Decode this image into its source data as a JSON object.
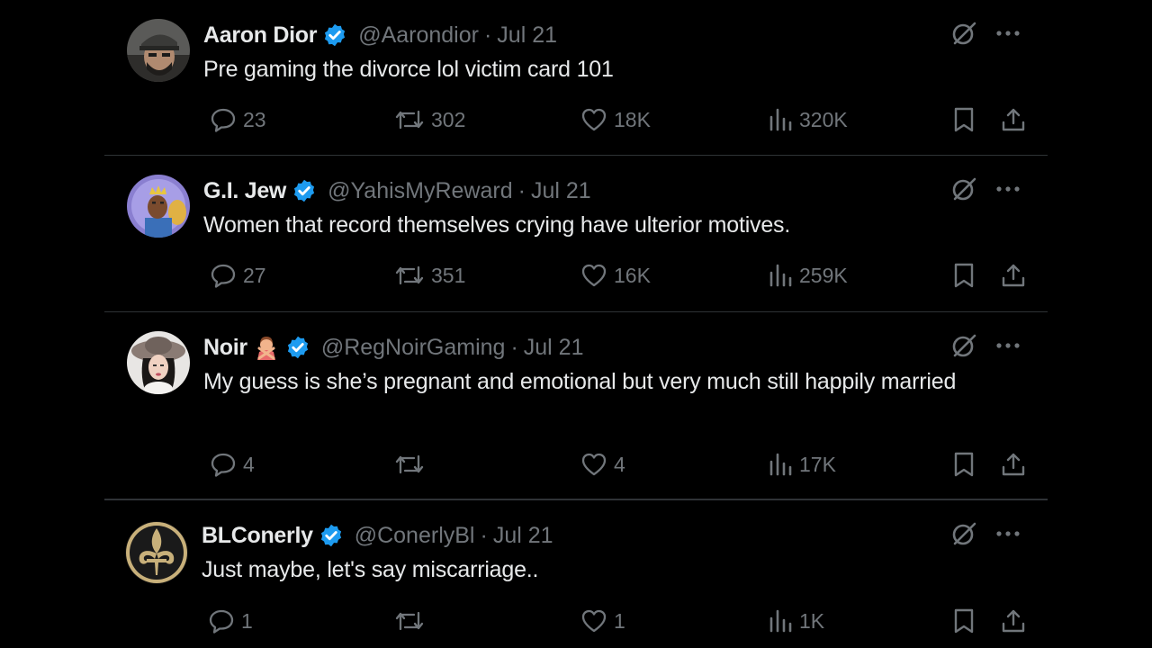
{
  "colors": {
    "background": "#000000",
    "text": "#e7e9ea",
    "muted": "#71767b",
    "verified": "#1d9bf0",
    "separator": "#2f3336"
  },
  "tweets": [
    {
      "name": "Aaron Dior",
      "handle": "@Aarondior",
      "date": "Jul 21",
      "text": "Pre gaming the divorce lol victim card 101",
      "replies": "23",
      "retweets": "302",
      "likes": "18K",
      "views": "320K",
      "avatar_icon": "avatar-man-cap-icon"
    },
    {
      "name": "G.I. Jew",
      "handle": "@YahisMyReward",
      "date": "Jul 21",
      "text": "Women that record themselves crying have ulterior motives.",
      "replies": "27",
      "retweets": "351",
      "likes": "16K",
      "views": "259K",
      "avatar_icon": "avatar-king-illustration-icon"
    },
    {
      "name": "Noir",
      "handle": "@RegNoirGaming",
      "date": "Jul 21",
      "text": "My guess is she’s pregnant and emotional but very much still happily married",
      "replies": "4",
      "retweets": "",
      "likes": "4",
      "views": "17K",
      "avatar_icon": "avatar-woman-hat-icon",
      "name_emoji": "person-gesturing-no-emoji"
    },
    {
      "name": "BLConerly",
      "handle": "@ConerlyBl",
      "date": "Jul 21",
      "text": "Just maybe, let's say miscarriage..",
      "replies": "1",
      "retweets": "",
      "likes": "1",
      "views": "1K",
      "avatar_icon": "avatar-fleur-de-lis-icon"
    }
  ]
}
